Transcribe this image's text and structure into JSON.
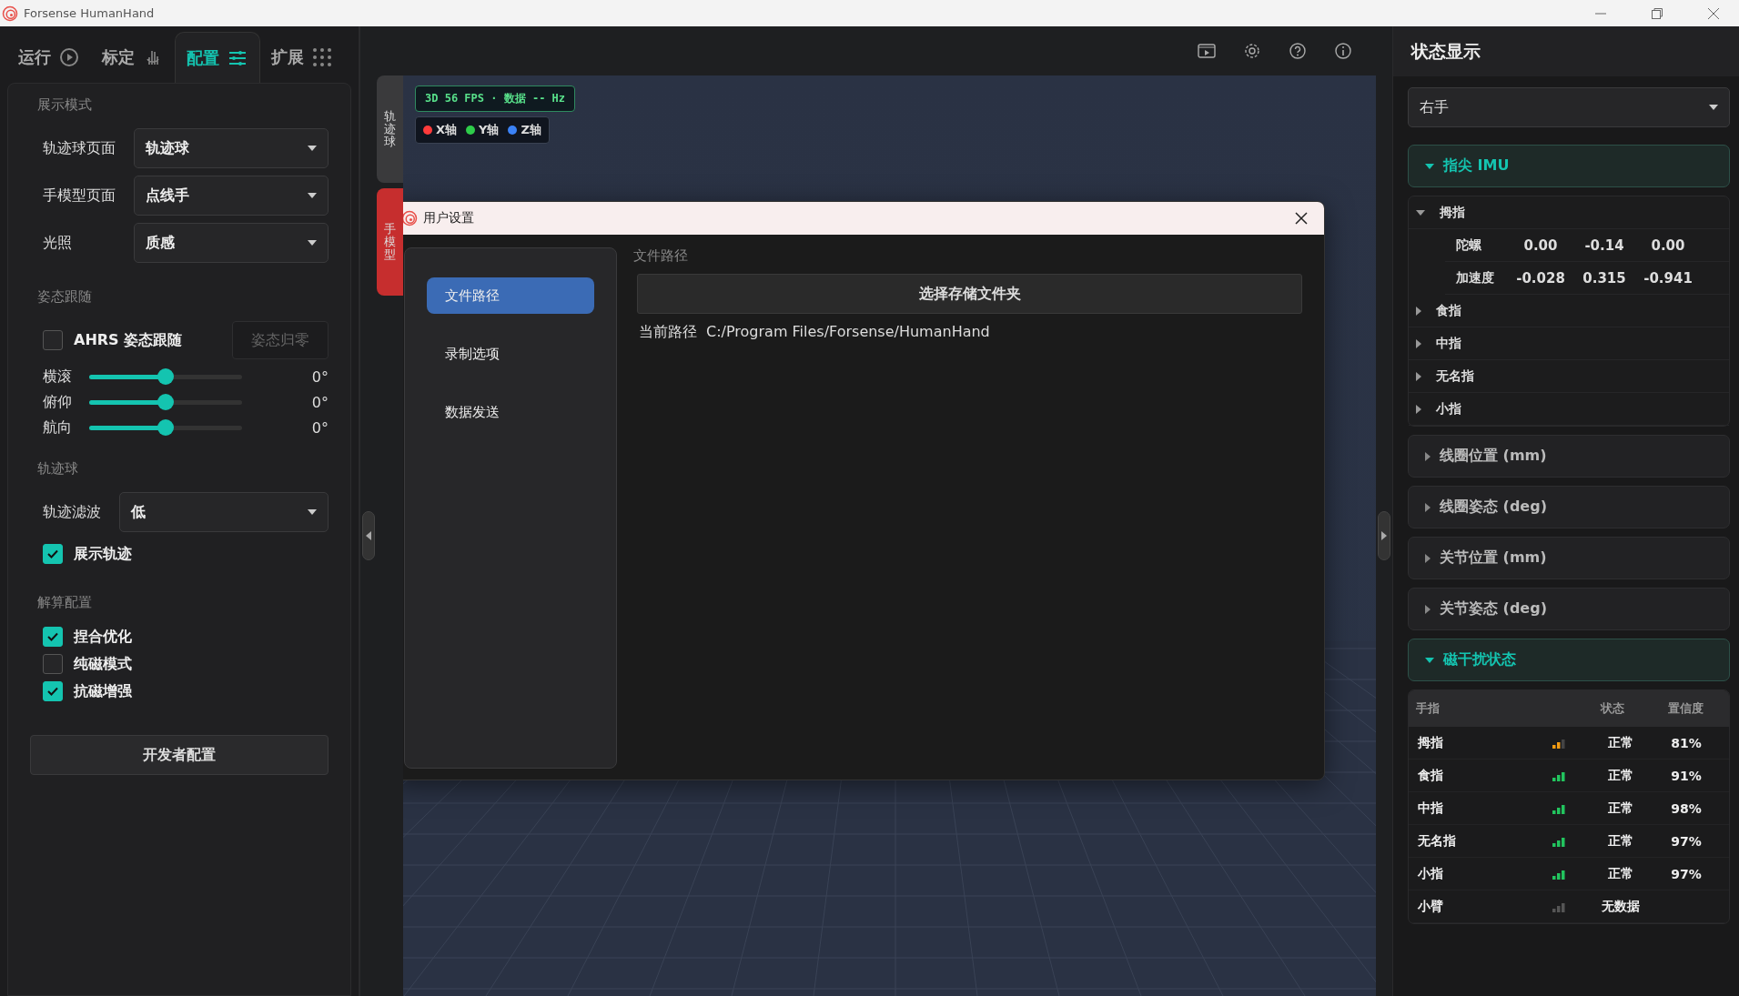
{
  "window": {
    "title": "Forsense HumanHand"
  },
  "main_tabs": [
    {
      "label": "运行",
      "selected": false
    },
    {
      "label": "标定",
      "selected": false
    },
    {
      "label": "配置",
      "selected": true
    },
    {
      "label": "扩展",
      "selected": false
    }
  ],
  "config": {
    "display_mode": {
      "title": "展示模式",
      "rows": [
        {
          "label": "轨迹球页面",
          "value": "轨迹球"
        },
        {
          "label": "手模型页面",
          "value": "点线手"
        },
        {
          "label": "光照",
          "value": "质感"
        }
      ]
    },
    "pose": {
      "title": "姿态跟随",
      "ahrs": {
        "label": "AHRS 姿态跟随",
        "checked": false
      },
      "reset_button": {
        "label": "姿态归零",
        "disabled": true
      },
      "sliders": [
        {
          "label": "横滚",
          "level": 0.5,
          "reading": "0°"
        },
        {
          "label": "俯仰",
          "level": 0.5,
          "reading": "0°"
        },
        {
          "label": "航向",
          "level": 0.5,
          "reading": "0°"
        }
      ]
    },
    "trackball": {
      "title": "轨迹球",
      "filter": {
        "label": "轨迹滤波",
        "value": "低"
      },
      "show_track": {
        "label": "展示轨迹",
        "checked": true
      }
    },
    "solver": {
      "title": "解算配置",
      "options": [
        {
          "label": "捏合优化",
          "checked": true
        },
        {
          "label": "纯磁模式",
          "checked": false
        },
        {
          "label": "抗磁增强",
          "checked": true
        }
      ]
    },
    "dev_button": "开发者配置"
  },
  "view_tabs": [
    {
      "label": "轨迹球",
      "selected": false
    },
    {
      "label": "手模型",
      "selected": true
    }
  ],
  "overlay": {
    "fps": "3D 56 FPS · 数据 -- Hz",
    "axes": [
      {
        "label": "X轴",
        "color": "#ff3b3b"
      },
      {
        "label": "Y轴",
        "color": "#2ecc4a"
      },
      {
        "label": "Z轴",
        "color": "#3b82f6"
      }
    ]
  },
  "dialog": {
    "title": "用户设置",
    "nav": [
      {
        "label": "文件路径",
        "selected": true
      },
      {
        "label": "录制选项",
        "selected": false
      },
      {
        "label": "数据发送",
        "selected": false
      }
    ],
    "section_title": "文件路径",
    "choose_button": "选择存储文件夹",
    "path_label": "当前路径",
    "path_value": "C:/Program Files/Forsense/HumanHand"
  },
  "status": {
    "title": "状态显示",
    "hand": "右手",
    "sections": [
      {
        "title": "指尖 IMU",
        "expanded": true,
        "kind": "tree"
      },
      {
        "title": "线圈位置 (mm)",
        "expanded": false
      },
      {
        "title": "线圈姿态 (deg)",
        "expanded": false
      },
      {
        "title": "关节位置 (mm)",
        "expanded": false
      },
      {
        "title": "关节姿态 (deg)",
        "expanded": false
      },
      {
        "title": "磁干扰状态",
        "expanded": true,
        "kind": "table"
      }
    ],
    "imu_tree": [
      {
        "label": "拇指",
        "expanded": true,
        "children": [
          {
            "label": "陀螺",
            "values": [
              "0.00",
              "-0.14",
              "0.00"
            ]
          },
          {
            "label": "加速度",
            "values": [
              "-0.028",
              "0.315",
              "-0.941"
            ]
          }
        ]
      },
      {
        "label": "食指",
        "expanded": false
      },
      {
        "label": "中指",
        "expanded": false
      },
      {
        "label": "无名指",
        "expanded": false
      },
      {
        "label": "小指",
        "expanded": false
      }
    ],
    "table": {
      "columns": [
        "手指",
        "状态",
        "置信度"
      ],
      "rows": [
        {
          "finger": "拇指",
          "kind": "medium",
          "color": "#f39c12",
          "status": "正常",
          "confidence": "81%"
        },
        {
          "finger": "食指",
          "kind": "high",
          "color": "#22c55e",
          "status": "正常",
          "confidence": "91%"
        },
        {
          "finger": "中指",
          "kind": "high",
          "color": "#22c55e",
          "status": "正常",
          "confidence": "98%"
        },
        {
          "finger": "无名指",
          "kind": "high",
          "color": "#22c55e",
          "status": "正常",
          "confidence": "97%"
        },
        {
          "finger": "小指",
          "kind": "high",
          "color": "#22c55e",
          "status": "正常",
          "confidence": "97%"
        },
        {
          "finger": "小臂",
          "kind": "none",
          "color": "#555555",
          "status": "无数据"
        }
      ]
    }
  }
}
